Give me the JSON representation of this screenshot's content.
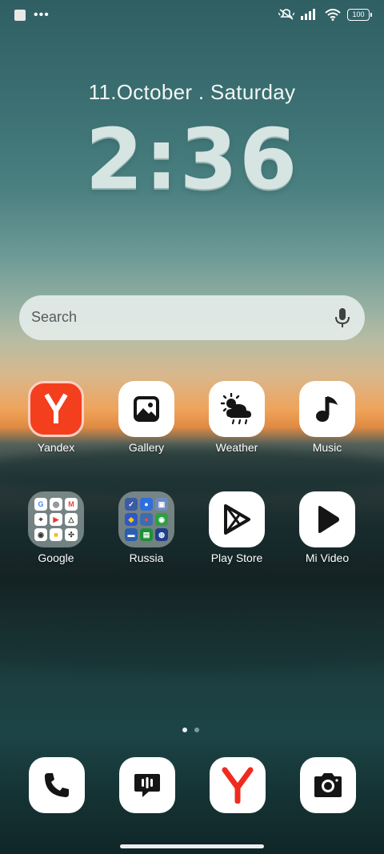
{
  "status_bar": {
    "left_icons": [
      "notification-square-icon",
      "more-dots-icon"
    ],
    "right_icons": [
      "mute-vibrate-icon",
      "signal-icon",
      "wifi-icon",
      "battery-icon"
    ],
    "battery_level": "100"
  },
  "lockclock": {
    "date": "11.October . Saturday",
    "time": "2:36"
  },
  "search": {
    "placeholder": "Search",
    "mic_icon": "microphone-icon"
  },
  "apps": [
    {
      "label": "Yandex",
      "icon": "yandex-icon"
    },
    {
      "label": "Gallery",
      "icon": "gallery-icon"
    },
    {
      "label": "Weather",
      "icon": "weather-icon"
    },
    {
      "label": "Music",
      "icon": "music-note-icon"
    },
    {
      "label": "Google",
      "icon": "folder-icon"
    },
    {
      "label": "Russia",
      "icon": "folder-icon"
    },
    {
      "label": "Play Store",
      "icon": "play-store-icon"
    },
    {
      "label": "Mi Video",
      "icon": "play-icon"
    }
  ],
  "page_indicator": {
    "count": 2,
    "active": 1
  },
  "dock": [
    {
      "icon": "phone-icon"
    },
    {
      "icon": "messages-icon"
    },
    {
      "icon": "yandex-browser-icon"
    },
    {
      "icon": "camera-icon"
    }
  ],
  "colors": {
    "yandex_red": "#f43f1e",
    "icon_dark": "#1a1a1a",
    "indicator_active": "#e8f0ee",
    "indicator_inactive": "#7f9a98"
  }
}
